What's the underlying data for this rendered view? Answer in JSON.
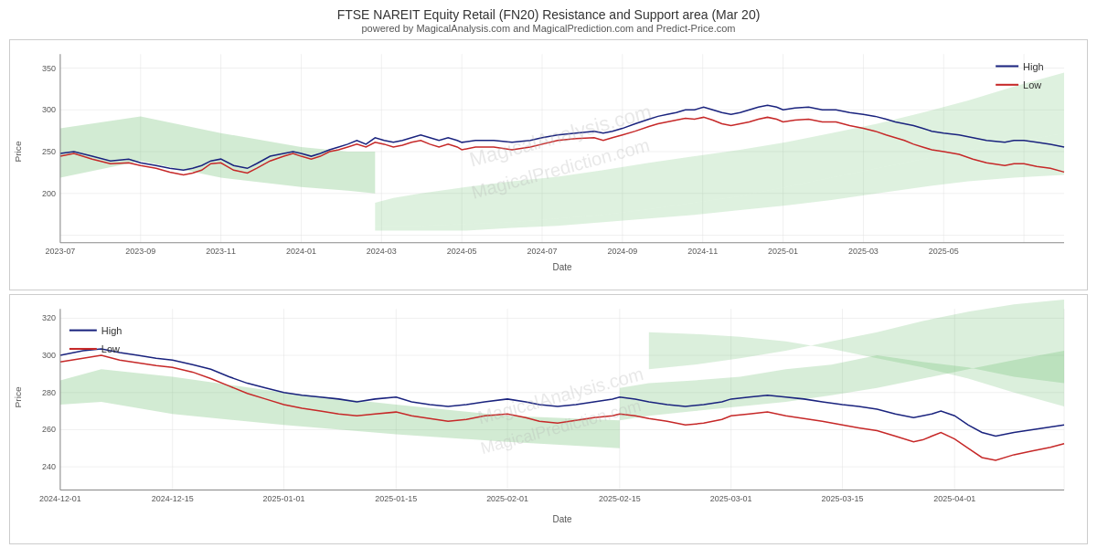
{
  "header": {
    "title": "FTSE NAREIT Equity Retail (FN20) Resistance and Support area (Mar 20)",
    "subtitle": "powered by MagicalAnalysis.com and MagicalPrediction.com and Predict-Price.com"
  },
  "chart1": {
    "y_axis_label": "Price",
    "x_axis_label": "Date",
    "y_ticks": [
      "350",
      "300",
      "250",
      "200"
    ],
    "x_ticks": [
      "2023-07",
      "2023-09",
      "2023-11",
      "2024-01",
      "2024-03",
      "2024-05",
      "2024-07",
      "2024-09",
      "2024-11",
      "2025-01",
      "2025-03",
      "2025-05"
    ],
    "legend": {
      "high_label": "High",
      "low_label": "Low"
    },
    "watermark": "MagicalAnalysis.com — MagicalPrediction.com"
  },
  "chart2": {
    "y_axis_label": "Price",
    "x_axis_label": "Date",
    "y_ticks": [
      "320",
      "300",
      "280",
      "260",
      "240"
    ],
    "x_ticks": [
      "2024-12-01",
      "2024-12-15",
      "2025-01-01",
      "2025-01-15",
      "2025-02-01",
      "2025-02-15",
      "2025-03-01",
      "2025-03-15",
      "2025-04-01"
    ],
    "legend": {
      "high_label": "High",
      "low_label": "Low"
    },
    "watermark": "MagicalAnalysis.com — MagicalPrediction.com"
  }
}
